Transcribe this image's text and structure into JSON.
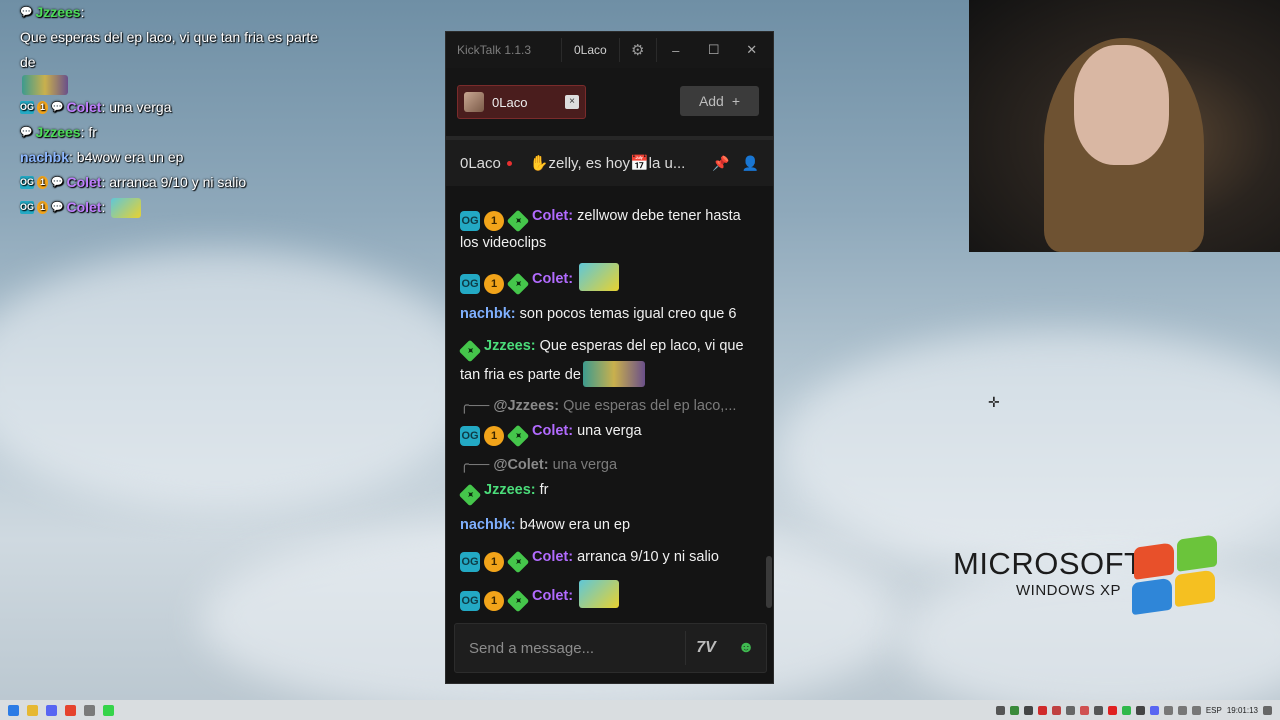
{
  "overlay": {
    "lines": [
      {
        "name": "Jzzees",
        "text": "Que esperas del ep laco, vi que tan fria es parte de",
        "name_color": "#4ddc5a",
        "badges": []
      },
      {
        "name": "Colet",
        "text": "una verga",
        "name_color": "#c080ff",
        "badges": [
          "og",
          "one"
        ]
      },
      {
        "name": "Jzzees",
        "text": "fr",
        "name_color": "#4ddc5a",
        "badges": []
      },
      {
        "name": "nachbk",
        "text": "b4wow era un ep",
        "name_color": "#8db8ff",
        "badges": []
      },
      {
        "name": "Colet",
        "text": "arranca 9/10 y ni salio",
        "name_color": "#c080ff",
        "badges": [
          "og",
          "one"
        ]
      },
      {
        "name": "Colet",
        "text": "",
        "name_color": "#c080ff",
        "badges": [
          "og",
          "one"
        ]
      }
    ]
  },
  "window": {
    "app_name": "KickTalk 1.1.3",
    "user": "0Laco",
    "tab_name": "0Laco",
    "tab_close": "×",
    "add_label": "Add",
    "add_icon": "+",
    "channel": {
      "name": "0Laco",
      "title": "✋zelly, es hoy📅la u..."
    },
    "messages": [
      {
        "reply": null,
        "badges": [
          "og",
          "one",
          "sub"
        ],
        "name": "Colet",
        "name_color": "#b26bff",
        "text": "zellwow debe tener hasta los videoclips",
        "emote": null
      },
      {
        "reply": null,
        "badges": [
          "og",
          "one",
          "sub"
        ],
        "name": "Colet",
        "name_color": "#b26bff",
        "text": "",
        "emote": "frog-emote"
      },
      {
        "reply": null,
        "badges": [],
        "name": "nachbk",
        "name_color": "#7fb0ff",
        "text": "son pocos temas igual creo que 6",
        "emote": null
      },
      {
        "reply": null,
        "badges": [
          "sub"
        ],
        "name": "Jzzees",
        "name_color": "#4bdc7a",
        "text": "Que esperas del ep laco, vi que tan fria es parte de",
        "emote": "wide-emote"
      },
      {
        "reply": {
          "to": "@Jzzees:",
          "text": "Que esperas del ep laco,..."
        },
        "badges": [
          "og",
          "one",
          "sub"
        ],
        "name": "Colet",
        "name_color": "#b26bff",
        "text": "una verga",
        "emote": null
      },
      {
        "reply": {
          "to": "@Colet:",
          "text": "una verga"
        },
        "badges": [
          "sub"
        ],
        "name": "Jzzees",
        "name_color": "#4bdc7a",
        "text": "fr",
        "emote": null
      },
      {
        "reply": null,
        "badges": [],
        "name": "nachbk",
        "name_color": "#7fb0ff",
        "text": "b4wow era un ep",
        "emote": null
      },
      {
        "reply": null,
        "badges": [
          "og",
          "one",
          "sub"
        ],
        "name": "Colet",
        "name_color": "#b26bff",
        "text": "arranca 9/10 y ni salio",
        "emote": null
      },
      {
        "reply": null,
        "badges": [
          "og",
          "one",
          "sub"
        ],
        "name": "Colet",
        "name_color": "#b26bff",
        "text": "",
        "emote": "frog-emote"
      }
    ],
    "input_placeholder": "Send a message..."
  },
  "desktop": {
    "logo_line1": "MICROSOFT",
    "logo_line2": "WINDOWS XP"
  },
  "taskbar": {
    "lang": "ESP",
    "time": "19:01:13"
  }
}
